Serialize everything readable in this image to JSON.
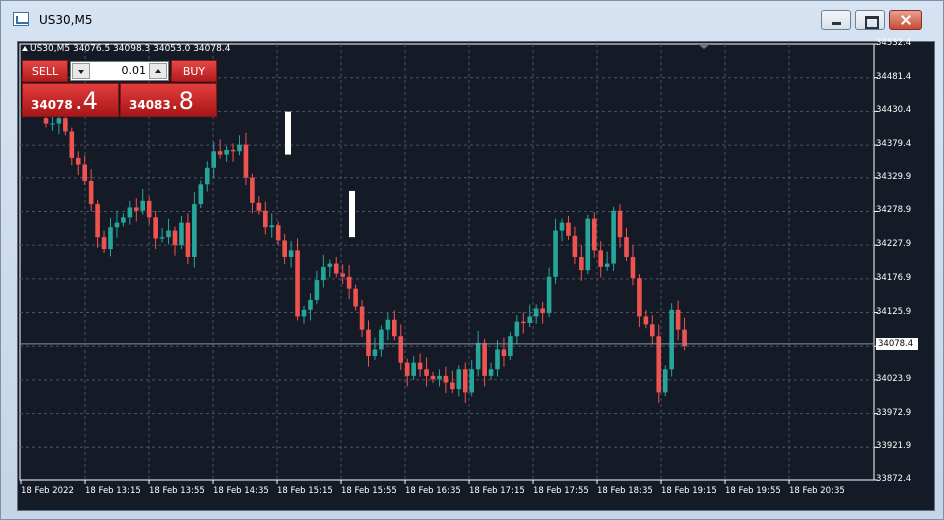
{
  "window": {
    "title": "US30,M5"
  },
  "chart_info": {
    "text": "US30,M5  34076.5 34098.3 34053.0 34078.4"
  },
  "trade_panel": {
    "sell_label": "SELL",
    "buy_label": "BUY",
    "lot_value": "0.01",
    "sell_price_big": "34078",
    "sell_price_frac": ".4",
    "buy_price_big": "34083",
    "buy_price_frac": ".8"
  },
  "current_price": "34078.4",
  "colors": {
    "bull": "#26a69a",
    "bear": "#ef5350",
    "background": "#141a26",
    "grid": "#4a5466"
  },
  "chart_data": {
    "type": "candlestick",
    "ylim": [
      33872.4,
      34532.4
    ],
    "y_ticks": [
      "34532.4",
      "34481.4",
      "34430.4",
      "34379.4",
      "34329.9",
      "34278.9",
      "34227.9",
      "34176.9",
      "34125.9",
      "34074.9",
      "34023.9",
      "33972.9",
      "33921.9",
      "33872.4"
    ],
    "x_ticks": [
      "18 Feb 2022",
      "18 Feb 13:15",
      "18 Feb 13:55",
      "18 Feb 14:35",
      "18 Feb 15:15",
      "18 Feb 15:55",
      "18 Feb 16:35",
      "18 Feb 17:15",
      "18 Feb 17:55",
      "18 Feb 18:35",
      "18 Feb 19:15",
      "18 Feb 19:55",
      "18 Feb 20:35"
    ],
    "candles_close": [
      34412,
      34412,
      34420,
      34400,
      34360,
      34350,
      34325,
      34290,
      34240,
      34222,
      34255,
      34262,
      34270,
      34285,
      34280,
      34295,
      34270,
      34238,
      34240,
      34250,
      34228,
      34262,
      34210,
      34290,
      34320,
      34345,
      34370,
      34365,
      34372,
      34370,
      34380,
      34330,
      34292,
      34280,
      34255,
      34258,
      34235,
      34210,
      34220,
      34120,
      34130,
      34145,
      34175,
      34195,
      34200,
      34185,
      34180,
      34162,
      34135,
      34100,
      34060,
      34070,
      34100,
      34115,
      34090,
      34050,
      34030,
      34050,
      34040,
      34030,
      34025,
      34030,
      34020,
      34010,
      34040,
      34005,
      34040,
      34080,
      34030,
      34040,
      34070,
      34060,
      34090,
      34112,
      34110,
      34120,
      34132,
      34125,
      34180,
      34250,
      34262,
      34242,
      34210,
      34190,
      34268,
      34220,
      34195,
      34200,
      34280,
      34240,
      34210,
      34178,
      34120,
      34108,
      34090,
      34005,
      34040,
      34130,
      34100,
      34075
    ],
    "last_price": 34078.4
  }
}
